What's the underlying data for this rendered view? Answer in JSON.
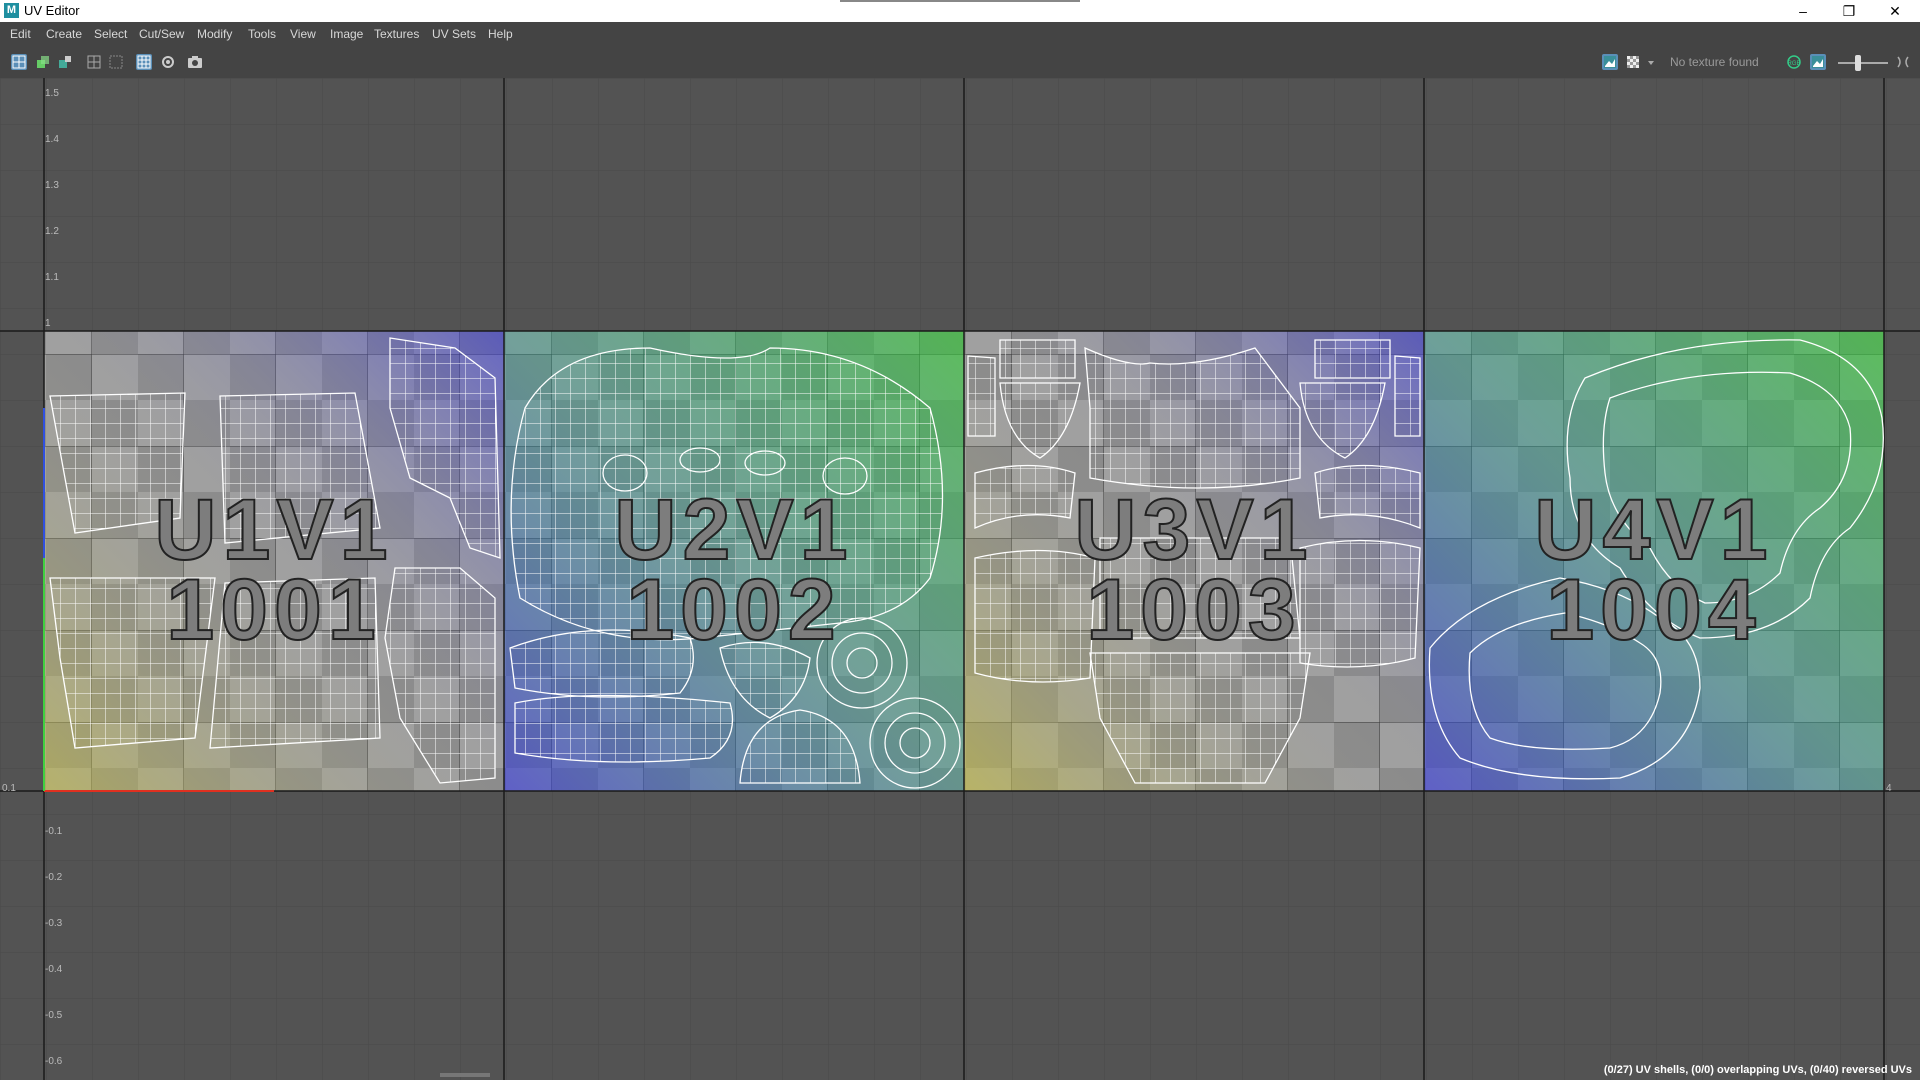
{
  "window": {
    "title": "UV Editor",
    "app_icon": "M"
  },
  "menu": [
    "Edit",
    "Create",
    "Select",
    "Cut/Sew",
    "Modify",
    "Tools",
    "View",
    "Image",
    "Textures",
    "UV Sets",
    "Help"
  ],
  "toolbar": {
    "texture_status": "No texture found",
    "rgb_label": "RGB"
  },
  "axis": {
    "v_labels": [
      "1.5",
      "1.4",
      "1.3",
      "1.2",
      "1.1",
      "1",
      "-0.1",
      "-0.2",
      "-0.3",
      "-0.4",
      "-0.5",
      "-0.6"
    ],
    "origin_label": "0.1",
    "right_label": "4"
  },
  "tiles": [
    {
      "udim_label": "U1V1",
      "udim_id": "1001"
    },
    {
      "udim_label": "U2V1",
      "udim_id": "1002"
    },
    {
      "udim_label": "U3V1",
      "udim_id": "1003"
    },
    {
      "udim_label": "U4V1",
      "udim_id": "1004"
    }
  ],
  "status": "(0/27) UV shells, (0/0) overlapping UVs, (0/40) reversed UVs",
  "colors": {
    "accent": "#5a8fb8",
    "wire": "#ffffff",
    "grid": "#2a2a2a"
  }
}
